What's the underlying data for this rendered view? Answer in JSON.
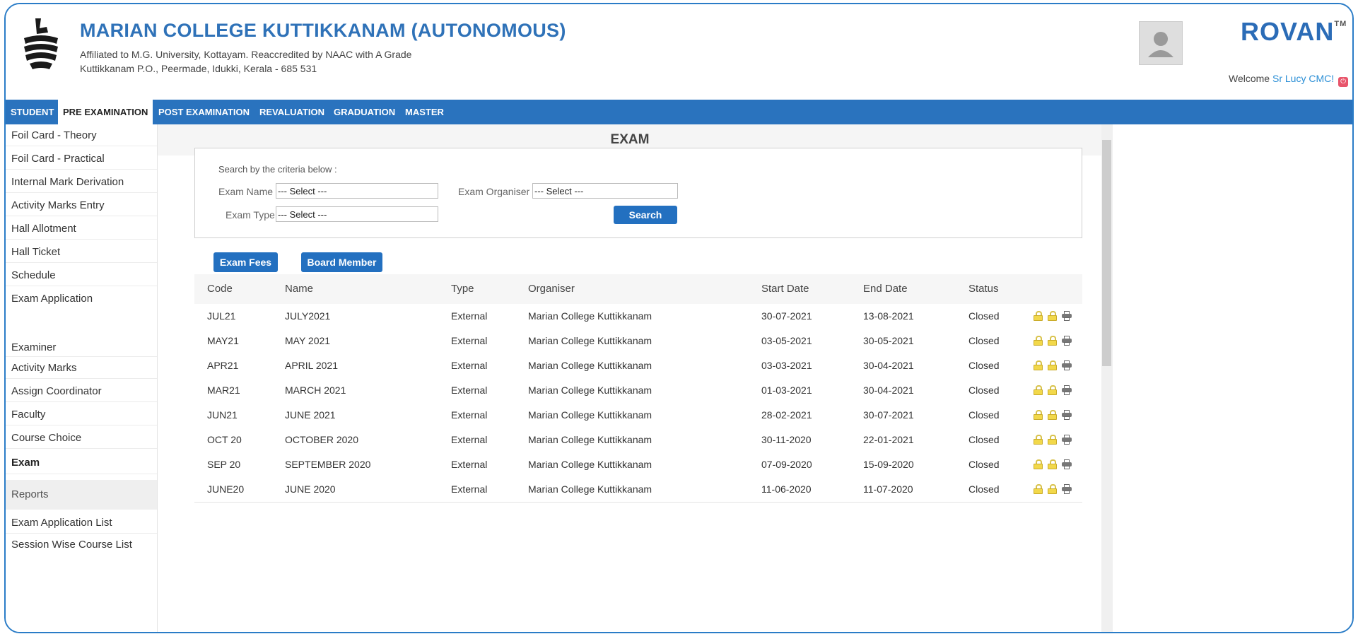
{
  "header": {
    "college_name": "MARIAN COLLEGE KUTTIKKANAM (AUTONOMOUS)",
    "affiliation_line1": "Affiliated to M.G. University, Kottayam. Reaccredited by NAAC with A Grade",
    "affiliation_line2": "Kuttikkanam P.O., Peermade, Idukki, Kerala - 685 531",
    "brand": "ROVAN",
    "brand_tm": "TM",
    "welcome_prefix": "Welcome ",
    "user_name": "Sr Lucy CMC!"
  },
  "nav": {
    "items": [
      "STUDENT",
      "PRE EXAMINATION",
      "POST EXAMINATION",
      "REVALUATION",
      "GRADUATION",
      "MASTER"
    ],
    "active": "PRE EXAMINATION"
  },
  "sidebar": {
    "items": [
      "Foil Card - Theory",
      "Foil Card - Practical",
      "Internal Mark Derivation",
      "Activity Marks Entry",
      "Hall Allotment",
      "Hall Ticket",
      "Schedule",
      "Exam Application"
    ],
    "items2": [
      "Examiner",
      "Activity Marks",
      "Assign Coordinator",
      "Faculty",
      "Course Choice",
      "Exam"
    ],
    "active": "Exam",
    "reports_heading": "Reports",
    "reports": [
      "Exam Application List",
      "Session Wise Course List"
    ]
  },
  "main": {
    "title": "EXAM",
    "search": {
      "caption": "Search by the criteria below :",
      "exam_name_label": "Exam Name",
      "exam_name_value": "--- Select ---",
      "exam_organiser_label": "Exam Organiser",
      "exam_organiser_value": "--- Select ---",
      "exam_type_label": "Exam Type",
      "exam_type_value": "--- Select ---",
      "search_button": "Search"
    },
    "buttons": {
      "exam_fees": "Exam Fees",
      "board_member": "Board Member"
    },
    "table": {
      "headers": [
        "Code",
        "Name",
        "Type",
        "Organiser",
        "Start Date",
        "End Date",
        "Status"
      ],
      "rows": [
        [
          "JUL21",
          "JULY2021",
          "External",
          "Marian College Kuttikkanam",
          "30-07-2021",
          "13-08-2021",
          "Closed"
        ],
        [
          "MAY21",
          "MAY 2021",
          "External",
          "Marian College Kuttikkanam",
          "03-05-2021",
          "30-05-2021",
          "Closed"
        ],
        [
          "APR21",
          "APRIL 2021",
          "External",
          "Marian College Kuttikkanam",
          "03-03-2021",
          "30-04-2021",
          "Closed"
        ],
        [
          "MAR21",
          "MARCH 2021",
          "External",
          "Marian College Kuttikkanam",
          "01-03-2021",
          "30-04-2021",
          "Closed"
        ],
        [
          "JUN21",
          "JUNE 2021",
          "External",
          "Marian College Kuttikkanam",
          "28-02-2021",
          "30-07-2021",
          "Closed"
        ],
        [
          "OCT 20",
          "OCTOBER 2020",
          "External",
          "Marian College Kuttikkanam",
          "30-11-2020",
          "22-01-2021",
          "Closed"
        ],
        [
          "SEP 20",
          "SEPTEMBER 2020",
          "External",
          "Marian College Kuttikkanam",
          "07-09-2020",
          "15-09-2020",
          "Closed"
        ],
        [
          "JUNE20",
          "JUNE 2020",
          "External",
          "Marian College Kuttikkanam",
          "11-06-2020",
          "11-07-2020",
          "Closed"
        ]
      ]
    }
  }
}
